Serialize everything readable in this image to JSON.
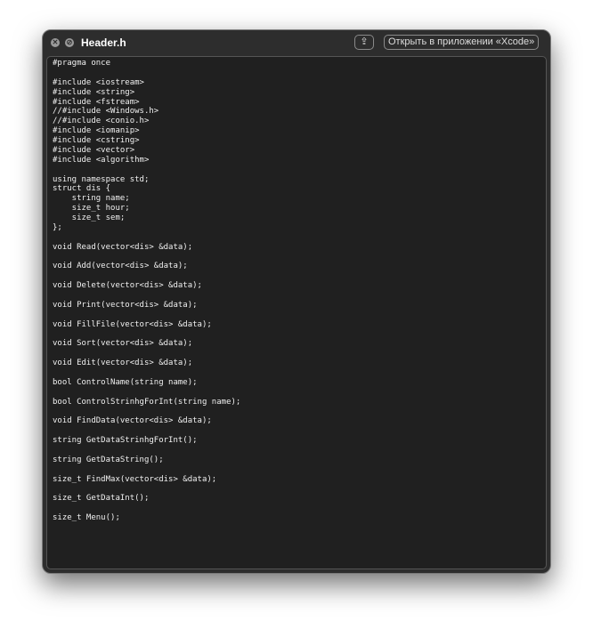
{
  "window": {
    "title": "Header.h",
    "open_with_label": "Открыть в приложении «Xcode»",
    "close_icon": "close-icon",
    "fullscreen_icon": "fullscreen-icon",
    "share_icon": "share-icon"
  },
  "code": "#pragma once\n\n#include <iostream>\n#include <string>\n#include <fstream>\n//#include <Windows.h>\n//#include <conio.h>\n#include <iomanip>\n#include <cstring>\n#include <vector>\n#include <algorithm>\n\nusing namespace std;\nstruct dis {\n    string name;\n    size_t hour;\n    size_t sem;\n};\n\nvoid Read(vector<dis> &data);\n\nvoid Add(vector<dis> &data);\n\nvoid Delete(vector<dis> &data);\n\nvoid Print(vector<dis> &data);\n\nvoid FillFile(vector<dis> &data);\n\nvoid Sort(vector<dis> &data);\n\nvoid Edit(vector<dis> &data);\n\nbool ControlName(string name);\n\nbool ControlStrinhgForInt(string name);\n\nvoid FindData(vector<dis> &data);\n\nstring GetDataStrinhgForInt();\n\nstring GetDataString();\n\nsize_t FindMax(vector<dis> &data);\n\nsize_t GetDataInt();\n\nsize_t Menu();"
}
